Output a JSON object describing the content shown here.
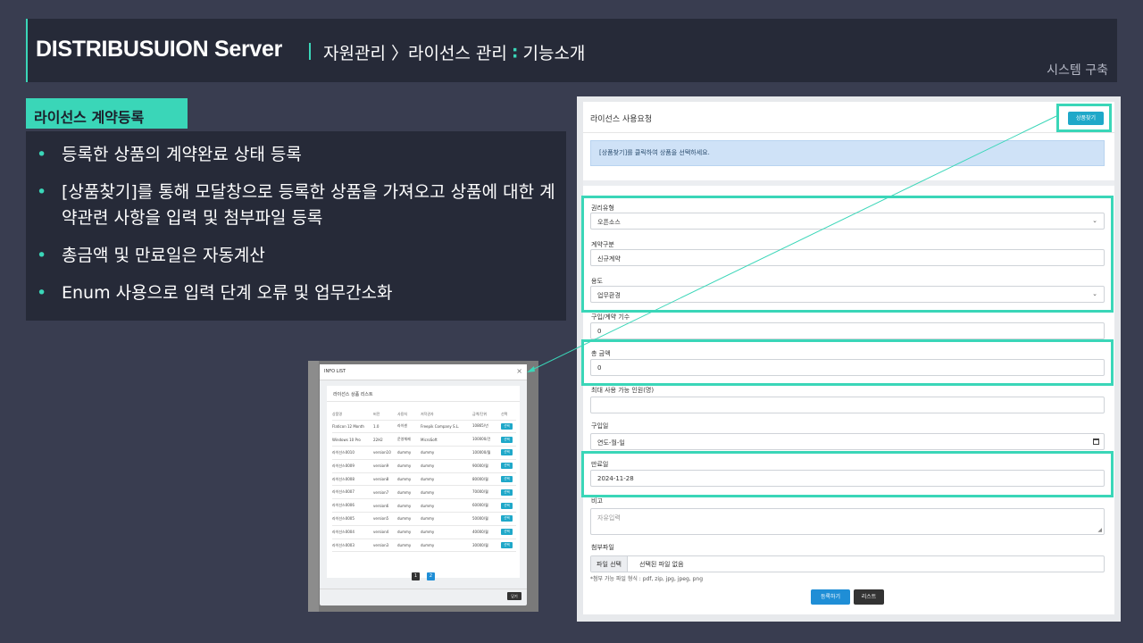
{
  "header": {
    "title": "DISTRIBUSUION Server",
    "crumb": "자원관리 〉라이선스 관리",
    "colon": "∶",
    "section": "기능소개",
    "subtitle": "시스템 구축"
  },
  "panel": {
    "tag": "라이선스 계약등록",
    "bullet": "•",
    "items": [
      "등록한 상품의 계약완료 상태 등록",
      "[상품찾기]를 통해 모달창으로 등록한 상품을 가져오고 상품에 대한 계약관련 사항을 입력 및 첨부파일 등록",
      "총금액 및 만료일은 자동계산",
      "Enum 사용으로 입력 단계 오류 및 업무간소화"
    ]
  },
  "modal": {
    "title": "INFO LIST",
    "close_icon": "×",
    "card_title": "라이선스 상품 리스트",
    "columns": [
      "상품명",
      "버전",
      "사용처",
      "저작권자",
      "금액/단위",
      "선택"
    ],
    "rows": [
      [
        "Flaticon 12 Month",
        "1.0",
        "라이센",
        "Freepik Company S.L.",
        "10865/년",
        "선택"
      ],
      [
        "Windows 10 Pro",
        "22H2",
        "운영체제",
        "MicroSoft",
        "100000/건",
        "선택"
      ],
      [
        "라이선스0010",
        "version10",
        "dummy",
        "dummy",
        "100000/월",
        "선택"
      ],
      [
        "라이선스0009",
        "version9",
        "dummy",
        "dummy",
        "90000/월",
        "선택"
      ],
      [
        "라이선스0008",
        "version8",
        "dummy",
        "dummy",
        "80000/월",
        "선택"
      ],
      [
        "라이선스0007",
        "version7",
        "dummy",
        "dummy",
        "70000/월",
        "선택"
      ],
      [
        "라이선스0006",
        "version6",
        "dummy",
        "dummy",
        "60000/월",
        "선택"
      ],
      [
        "라이선스0005",
        "version5",
        "dummy",
        "dummy",
        "50000/월",
        "선택"
      ],
      [
        "라이선스0004",
        "version4",
        "dummy",
        "dummy",
        "40000/월",
        "선택"
      ],
      [
        "라이선스0003",
        "version3",
        "dummy",
        "dummy",
        "30000/월",
        "선택"
      ]
    ],
    "pages": [
      "1",
      "2"
    ],
    "active_page": "2",
    "close_label": "닫기"
  },
  "form": {
    "title": "라이선스 사용요청",
    "find_button": "상품찾기",
    "alert": "[상품찾기]를 클릭하여 상품을 선택하세요.",
    "rights_type_label": "권리유형",
    "rights_type_value": "오픈소스",
    "contract_label": "계약구분",
    "contract_value": "신규계약",
    "usage_label": "용도",
    "usage_value": "업무환경",
    "purchase_count_label": "구입/계약 기수",
    "purchase_count_value": "0",
    "total_label": "총 금액",
    "total_value": "0",
    "max_users_label": "최대 사용 가능 인원(명)",
    "purchase_date_label": "구입일",
    "purchase_date_placeholder": "연도-월-일",
    "expiry_label": "만료일",
    "expiry_value": "2024-11-28",
    "note_label": "비고",
    "note_placeholder": "자유입력",
    "attach_label": "첨부파일",
    "file_button": "파일 선택",
    "file_status": "선택된 파일 없음",
    "file_hint": "*첨부 가능 파일 형식 : pdf, zip, jpg, jpeg, png",
    "submit_label": "등록하기",
    "list_label": "리스트",
    "dropdown_icon": "chevron-down",
    "calendar_icon": "calendar"
  },
  "colors": {
    "accent": "#3ad6b8",
    "background": "#393d50",
    "panel": "#262a38",
    "primary_button": "#1f8ed6",
    "find_button": "#1fa8c9"
  }
}
